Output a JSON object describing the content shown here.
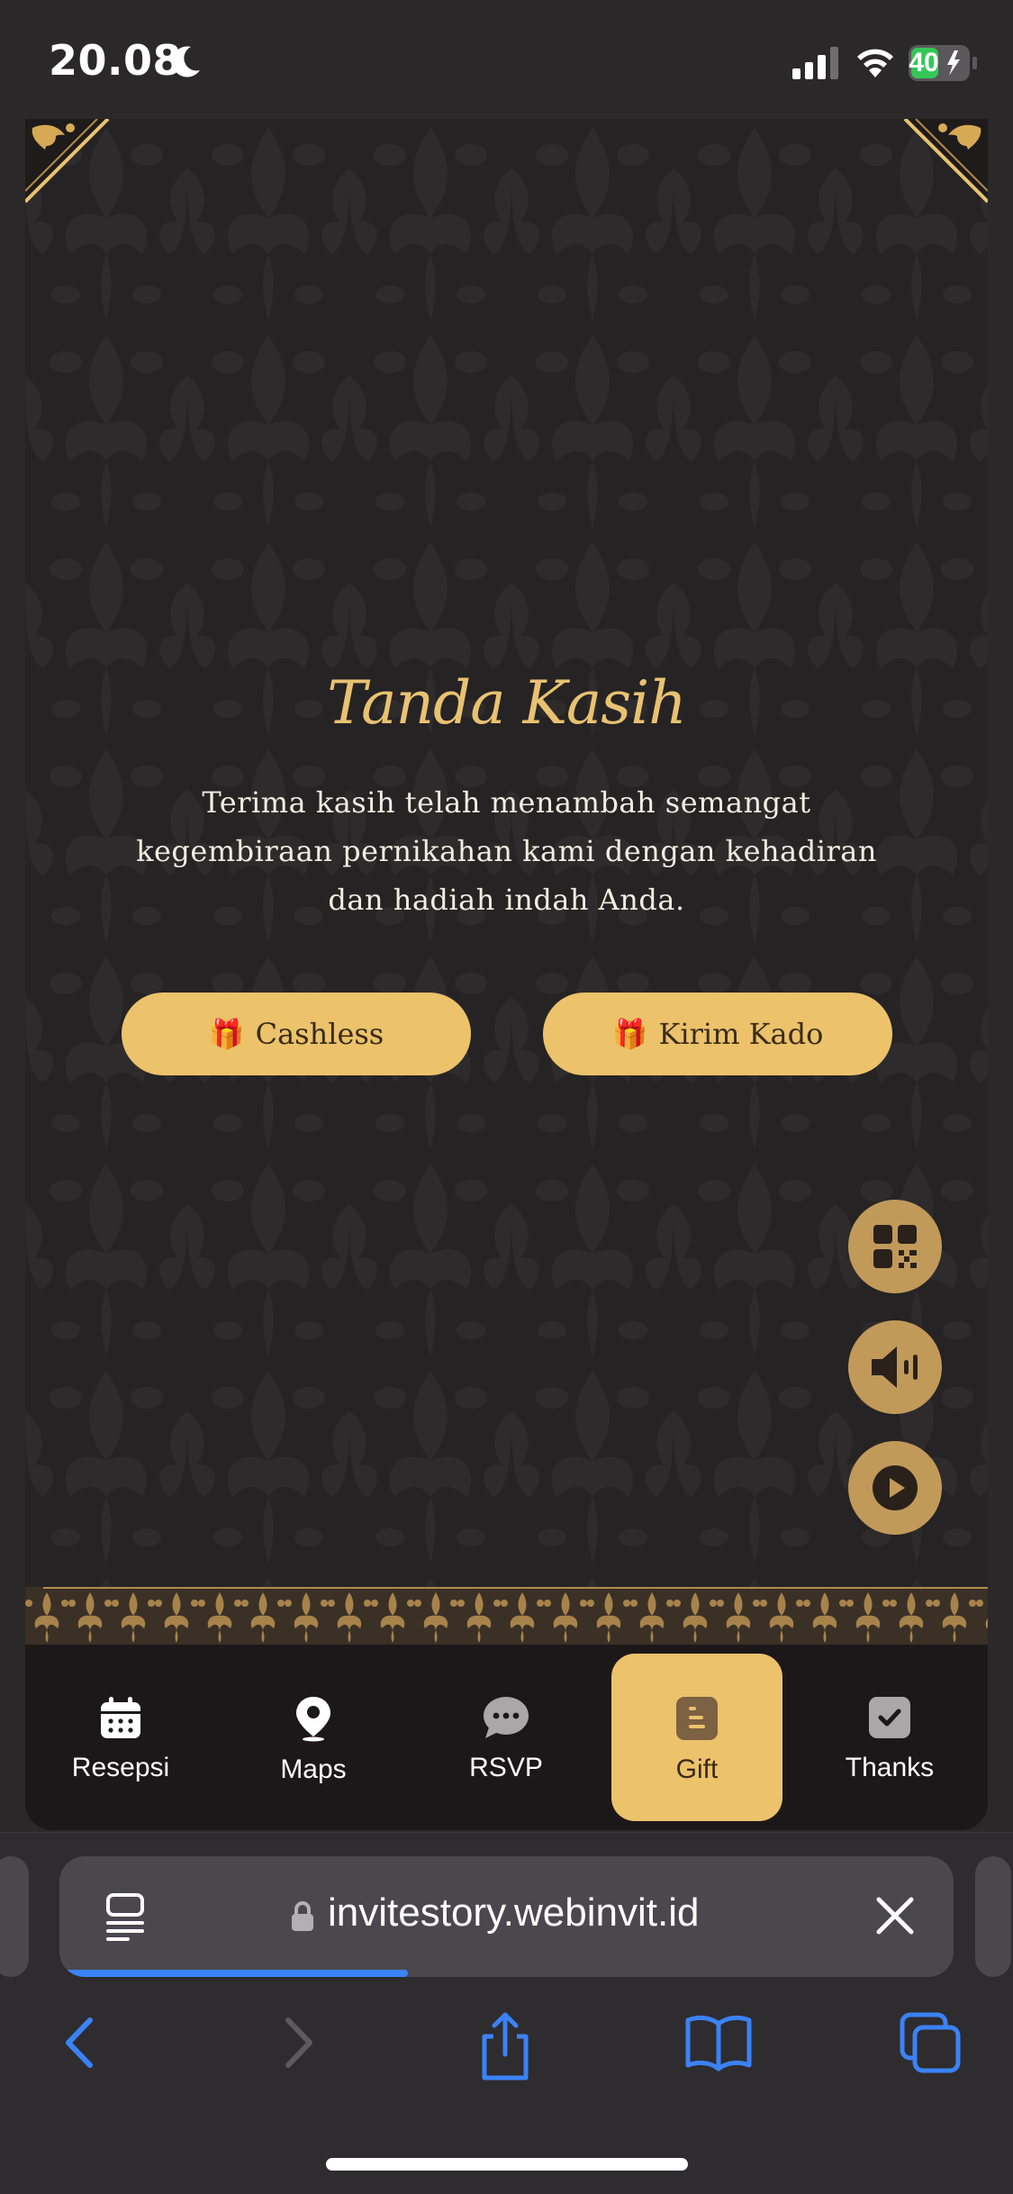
{
  "status": {
    "time": "20.08",
    "battery": "40"
  },
  "gift": {
    "title": "Tanda Kasih",
    "text": "Terima kasih telah menambah semangat kegembiraan pernikahan kami dengan kehadiran dan hadiah indah Anda.",
    "cashless_label": "Cashless",
    "kado_label": "Kirim Kado",
    "button_emoji": "🎁"
  },
  "nav": {
    "items": [
      {
        "label": "Resepsi",
        "icon": "calendar-icon"
      },
      {
        "label": "Maps",
        "icon": "map-pin-icon"
      },
      {
        "label": "RSVP",
        "icon": "chat-bubble-icon"
      },
      {
        "label": "Gift",
        "icon": "gift-document-icon",
        "active": true
      },
      {
        "label": "Thanks",
        "icon": "check-square-icon"
      }
    ]
  },
  "floating": {
    "icons": [
      "qr-code-icon",
      "speaker-icon",
      "play-icon"
    ]
  },
  "browser": {
    "url": "invitestory.webinvit.id",
    "load_progress": 0.39
  },
  "colors": {
    "gold": "#ecc26b",
    "gold_text": "#e8c270",
    "fab": "#c19a5a",
    "page_bg": "#262324",
    "nav_bg": "#1c1819",
    "progress": "#3b82f6"
  }
}
